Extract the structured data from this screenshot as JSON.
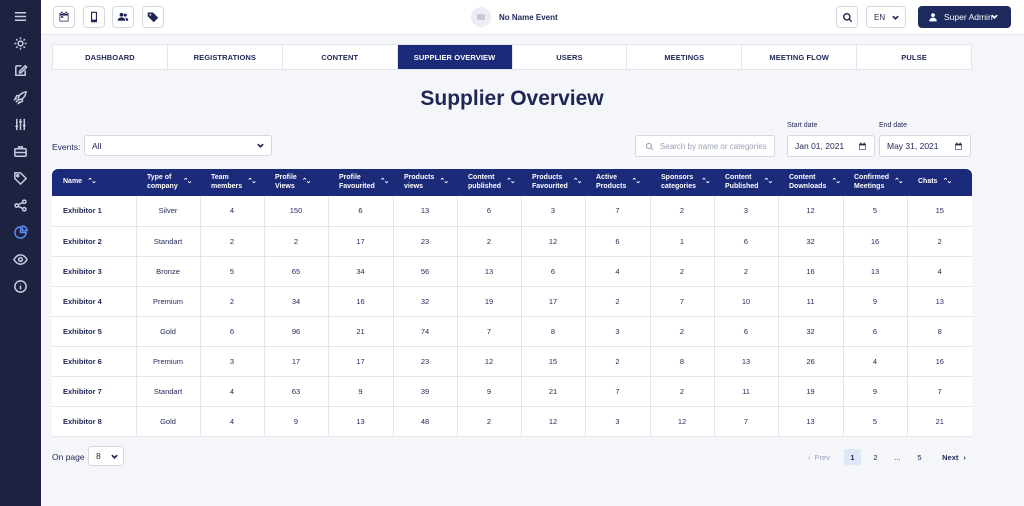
{
  "topbar": {
    "event_name": "No Name Event",
    "language": "EN",
    "user_label": "Super Admin"
  },
  "tabs": [
    {
      "label": "DASHBOARD"
    },
    {
      "label": "REGISTRATIONS"
    },
    {
      "label": "CONTENT"
    },
    {
      "label": "SUPPLIER OVERVIEW",
      "active": true
    },
    {
      "label": "USERS"
    },
    {
      "label": "MEETINGS"
    },
    {
      "label": "MEETING FLOW"
    },
    {
      "label": "PULSE"
    }
  ],
  "page": {
    "title": "Supplier Overview"
  },
  "filters": {
    "events_label": "Events:",
    "events_value": "All",
    "search_placeholder": "Search by name or categories",
    "start_label": "Start date",
    "start_value": "Jan 01, 2021",
    "end_label": "End date",
    "end_value": "May 31, 2021"
  },
  "table": {
    "columns": [
      [
        "Name"
      ],
      [
        "Type of",
        "company"
      ],
      [
        "Team",
        "members"
      ],
      [
        "Profile",
        "Views"
      ],
      [
        "Profile",
        "Favourited"
      ],
      [
        "Products",
        "views"
      ],
      [
        "Content",
        "published"
      ],
      [
        "Products",
        "Favourited"
      ],
      [
        "Active",
        "Products"
      ],
      [
        "Sponsors",
        "categories"
      ],
      [
        "Content",
        "Published"
      ],
      [
        "Content",
        "Downloads"
      ],
      [
        "Confirmed",
        "Meetings"
      ],
      [
        "Chats"
      ]
    ],
    "rows": [
      [
        "Exhibitor 1",
        "Silver",
        "4",
        "150",
        "6",
        "13",
        "6",
        "3",
        "7",
        "2",
        "3",
        "12",
        "5",
        "15"
      ],
      [
        "Exhibitor 2",
        "Standart",
        "2",
        "2",
        "17",
        "23",
        "2",
        "12",
        "6",
        "1",
        "6",
        "32",
        "16",
        "2"
      ],
      [
        "Exhibitor 3",
        "Bronze",
        "5",
        "65",
        "34",
        "56",
        "13",
        "6",
        "4",
        "2",
        "2",
        "16",
        "13",
        "4"
      ],
      [
        "Exhibitor 4",
        "Premium",
        "2",
        "34",
        "16",
        "32",
        "19",
        "17",
        "2",
        "7",
        "10",
        "11",
        "9",
        "13"
      ],
      [
        "Exhibitor 5",
        "Gold",
        "6",
        "96",
        "21",
        "74",
        "7",
        "8",
        "3",
        "2",
        "6",
        "32",
        "6",
        "8"
      ],
      [
        "Exhibitor 6",
        "Premium",
        "3",
        "17",
        "17",
        "23",
        "12",
        "15",
        "2",
        "8",
        "13",
        "26",
        "4",
        "16"
      ],
      [
        "Exhibitor 7",
        "Standart",
        "4",
        "63",
        "9",
        "39",
        "9",
        "21",
        "7",
        "2",
        "11",
        "19",
        "9",
        "7"
      ],
      [
        "Exhibitor 8",
        "Gold",
        "4",
        "9",
        "13",
        "48",
        "2",
        "12",
        "3",
        "12",
        "7",
        "13",
        "5",
        "21"
      ]
    ]
  },
  "pagination": {
    "on_page_label": "On page",
    "on_page_value": "8",
    "prev": "Prev",
    "pages": [
      "1",
      "2",
      "...",
      "5"
    ],
    "current": "1",
    "next": "Next"
  },
  "colors": {
    "sidebar": "#1c2240",
    "accent": "#1c2a7a",
    "text": "#1f2656"
  },
  "sidebar_icons": [
    "menu-icon",
    "settings-icon",
    "edit-icon",
    "rocket-icon",
    "sliders-icon",
    "briefcase-icon",
    "tag-icon",
    "share-icon",
    "pie-chart-icon",
    "eye-icon",
    "info-icon"
  ],
  "topbar_icons": [
    "calendar-icon",
    "mobile-icon",
    "users-icon",
    "tag-icon"
  ]
}
